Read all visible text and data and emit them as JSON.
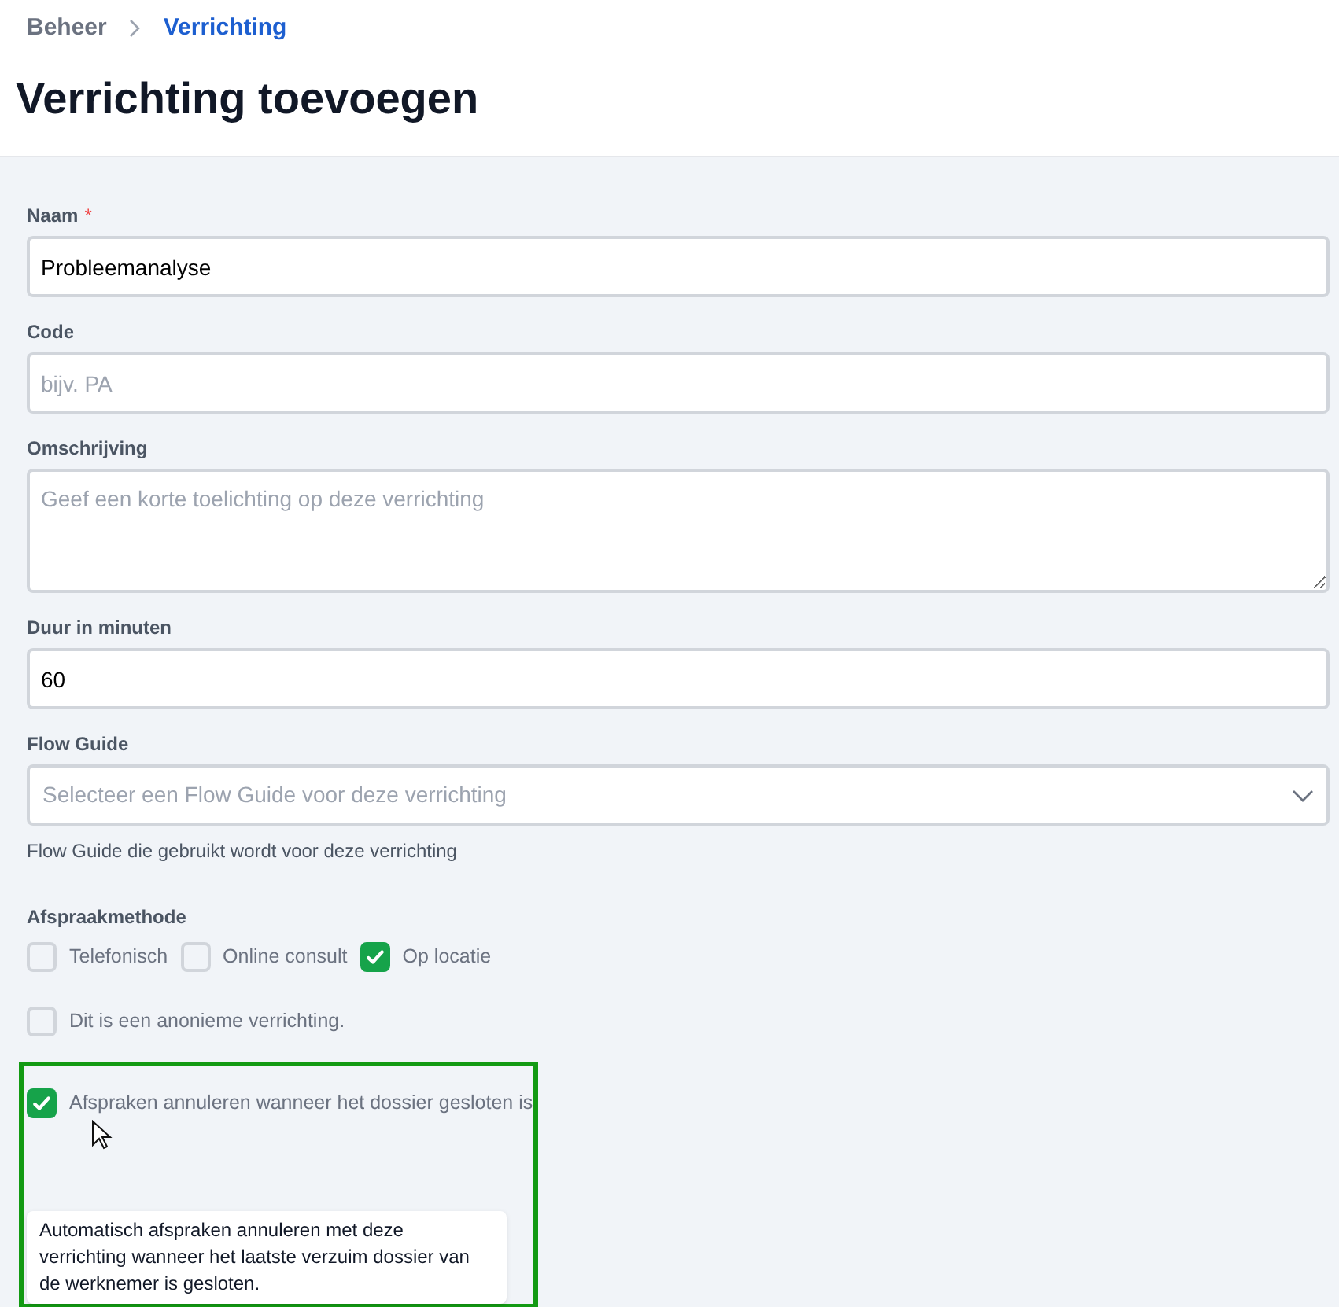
{
  "breadcrumb": [
    {
      "label": "Beheer",
      "current": false
    },
    {
      "label": "Verrichting",
      "current": true
    }
  ],
  "title": "Verrichting toevoegen",
  "fields": [
    {
      "kind": "input",
      "label": "Naam",
      "required_mark": "*",
      "value": "Probleemanalyse"
    },
    {
      "kind": "input",
      "label": "Code",
      "placeholder": "bijv. PA"
    },
    {
      "kind": "textarea",
      "label": "Omschrijving",
      "placeholder": "Geef een korte toelichting op deze verrichting"
    },
    {
      "kind": "input",
      "label": "Duur in minuten",
      "value": "60"
    },
    {
      "kind": "select",
      "label": "Flow Guide",
      "placeholder": "Selecteer een Flow Guide voor deze verrichting",
      "help": "Flow Guide die gebruikt wordt voor deze verrichting"
    }
  ],
  "appointment_method": {
    "label": "Afspraakmethode",
    "options": [
      {
        "label": "Telefonisch",
        "checked": false
      },
      {
        "label": "Online consult",
        "checked": false
      },
      {
        "label": "Op locatie",
        "checked": true
      }
    ]
  },
  "anonymous": {
    "label": "Dit is een anonieme verrichting.",
    "checked": false
  },
  "cancel_on_close": {
    "label": "Afspraken annuleren wanneer het dossier gesloten is",
    "checked": true,
    "tooltip": "Automatisch afspraken annuleren met deze verrichting wanneer het laatste verzuim dossier van de werknemer is gesloten."
  }
}
